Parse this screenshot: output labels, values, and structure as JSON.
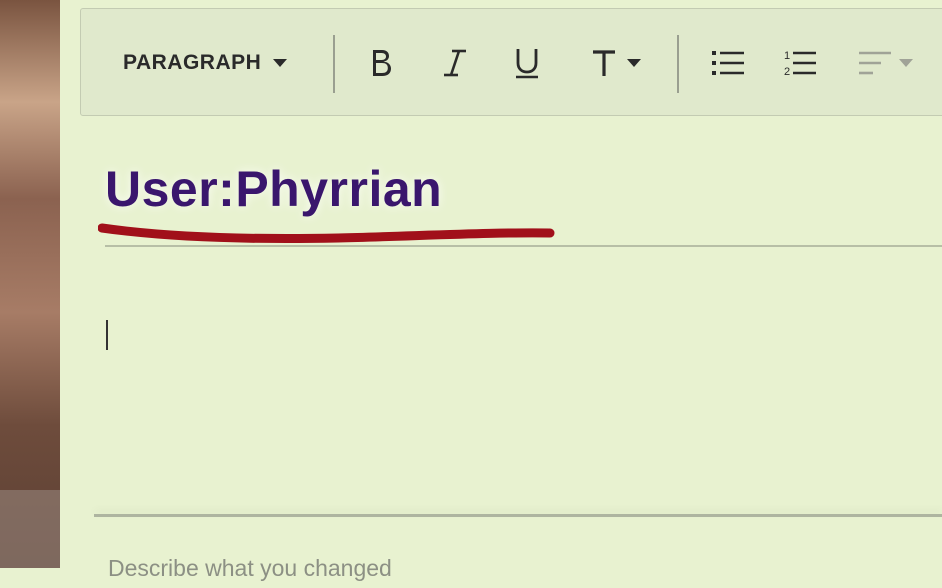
{
  "toolbar": {
    "paragraph_label": "PARAGRAPH",
    "icons": [
      "bold-icon",
      "italic-icon",
      "underline-icon",
      "text-style-icon",
      "bulleted-list-icon",
      "numbered-list-icon",
      "align-icon"
    ]
  },
  "page": {
    "title": "User:Phyrrian"
  },
  "summary": {
    "placeholder": "Describe what you changed"
  },
  "colors": {
    "background": "#e8f2d0",
    "title": "#3a166d",
    "annotation": "#a1101a"
  }
}
